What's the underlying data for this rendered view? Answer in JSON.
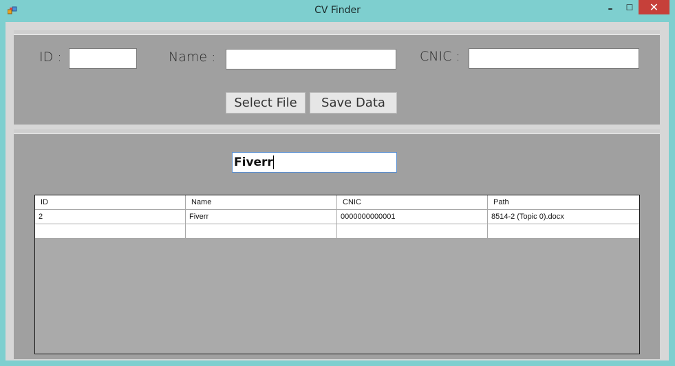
{
  "window": {
    "title": "CV Finder",
    "minimize_glyph": "–",
    "maximize_glyph": "☐",
    "close_glyph": "✕"
  },
  "form": {
    "id_label": "ID :",
    "id_value": "",
    "name_label": "Name :",
    "name_value": "",
    "cnic_label": "CNIC :",
    "cnic_value": "",
    "select_file_label": "Select File",
    "save_data_label": "Save Data"
  },
  "search": {
    "value": "Fiverr"
  },
  "grid": {
    "columns": [
      "ID",
      "Name",
      "CNIC",
      "Path"
    ],
    "rows": [
      [
        "2",
        "Fiverr",
        "0000000000001",
        "8514-2 (Topic 0).docx"
      ],
      [
        "",
        "",
        "",
        ""
      ]
    ]
  },
  "colors": {
    "window_frame": "#7ecfcf",
    "panel": "#a0a0a0",
    "close_button": "#c6403a",
    "search_focus_border": "#5a8fd1"
  }
}
